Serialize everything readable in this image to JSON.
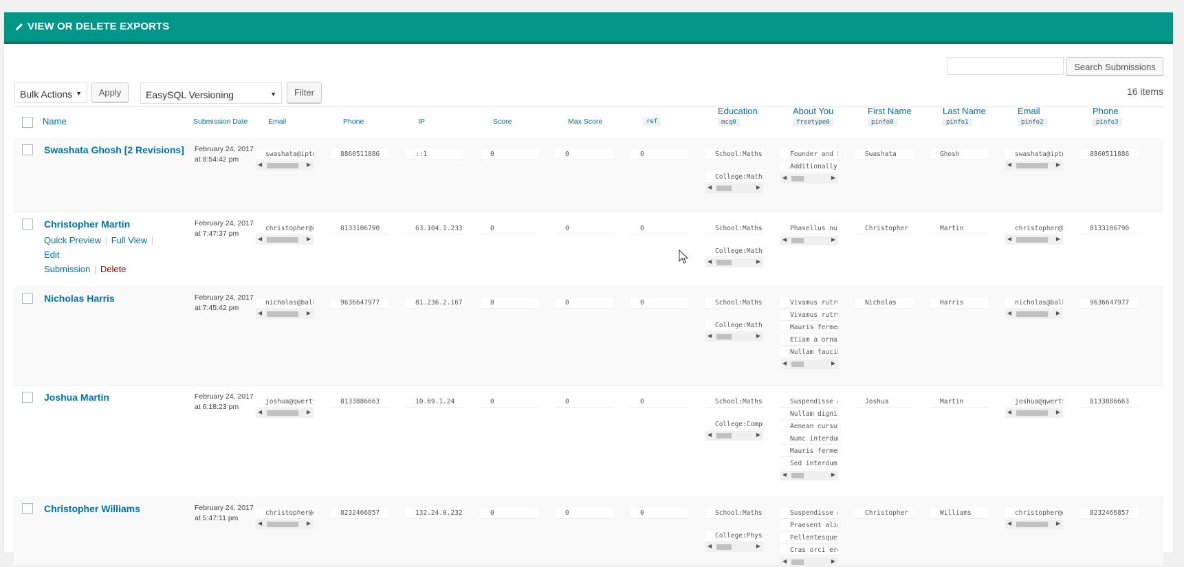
{
  "header": {
    "title": "VIEW OR DELETE EXPORTS"
  },
  "toolbar": {
    "bulk_actions": "Bulk Actions",
    "apply": "Apply",
    "version_select": "EasySQL Versioning",
    "filter": "Filter",
    "search_button": "Search Submissions",
    "search_value": "",
    "items_count": "16 items"
  },
  "columns": [
    {
      "label": "Name",
      "sub": ""
    },
    {
      "label": "Submission Date",
      "sub": ""
    },
    {
      "label": "Email",
      "sub": ""
    },
    {
      "label": "Phone",
      "sub": ""
    },
    {
      "label": "IP",
      "sub": ""
    },
    {
      "label": "Score",
      "sub": ""
    },
    {
      "label": "Max Score",
      "sub": ""
    },
    {
      "label": "",
      "sub": "ref"
    },
    {
      "label": "Education",
      "sub": "mcq0"
    },
    {
      "label": "About You",
      "sub": "freetype0"
    },
    {
      "label": "First Name",
      "sub": "pinfo0"
    },
    {
      "label": "Last Name",
      "sub": "pinfo1"
    },
    {
      "label": "Email",
      "sub": "pinfo2"
    },
    {
      "label": "Phone",
      "sub": "pinfo3"
    }
  ],
  "row_actions": {
    "quick_preview": "Quick Preview",
    "full_view": "Full View",
    "edit": "Edit",
    "submission": "Submission",
    "delete": "Delete"
  },
  "rows": [
    {
      "name": "Swashata Ghosh [2 Revisions]",
      "date": "February 24, 2017",
      "time": "at 8:54:42 pm",
      "email": "swashata@iptms",
      "phone": "8860511886",
      "ip": "::1",
      "score": "0",
      "max_score": "0",
      "ref": "0",
      "education": [
        "School:Maths:F",
        "College:Maths:"
      ],
      "about": [
        "Founder and Le",
        "Additionally a"
      ],
      "first": "Swashata",
      "last": "Ghosh",
      "email2": "swashata@iptms",
      "phone2": "8860511886"
    },
    {
      "name": "Christopher Martin",
      "date": "February 24, 2017",
      "time": "at 7:47:37 pm",
      "email": "christopher@ba",
      "phone": "8133106790",
      "ip": "63.104.1.233",
      "score": "0",
      "max_score": "0",
      "ref": "0",
      "education": [
        "School:Maths:F",
        "College:Maths:"
      ],
      "about": [
        "Phasellus null"
      ],
      "first": "Christopher",
      "last": "Martin",
      "email2": "christopher@ba",
      "phone2": "8133106790"
    },
    {
      "name": "Nicholas Harris",
      "date": "February 24, 2017",
      "time": "at 7:45:42 pm",
      "email": "nicholas@balbt",
      "phone": "9636647977",
      "ip": "81.236.2.167",
      "score": "0",
      "max_score": "0",
      "ref": "0",
      "education": [
        "School:Maths:F",
        "College:Maths:"
      ],
      "about": [
        "Vivamus rutrum",
        "Vivamus rutrum",
        "Mauris ferment",
        "Etiam a ornare",
        "Nullam faucibu"
      ],
      "first": "Nicholas",
      "last": "Harris",
      "email2": "nicholas@balbt",
      "phone2": "9636647977"
    },
    {
      "name": "Joshua Martin",
      "date": "February 24, 2017",
      "time": "at 6:18:23 pm",
      "email": "joshua@qwerty.",
      "phone": "8133886663",
      "ip": "10.69.1.24",
      "score": "0",
      "max_score": "0",
      "ref": "0",
      "education": [
        "School:Maths:C",
        "College:Comput"
      ],
      "about": [
        "Suspendisse at",
        "Nullam digniss",
        "Aenean cursus",
        "Nunc interdum,",
        "Mauris ferment",
        "Sed interdum l"
      ],
      "first": "Joshua",
      "last": "Martin",
      "email2": "joshua@qwerty.",
      "phone2": "8133886663"
    },
    {
      "name": "Christopher Williams",
      "date": "February 24, 2017",
      "time": "at 5:47:11 pm",
      "email": "christopher@qw",
      "phone": "8232466857",
      "ip": "132.24.0.232",
      "score": "0",
      "max_score": "0",
      "ref": "0",
      "education": [
        "School:Maths:F",
        "College:Physic"
      ],
      "about": [
        "Suspendisse at",
        "Praesent aliqu",
        "Pellentesque p",
        "Cras orci eros"
      ],
      "first": "Christopher",
      "last": "Williams",
      "email2": "christopher@qw",
      "phone2": "8232466857"
    }
  ]
}
